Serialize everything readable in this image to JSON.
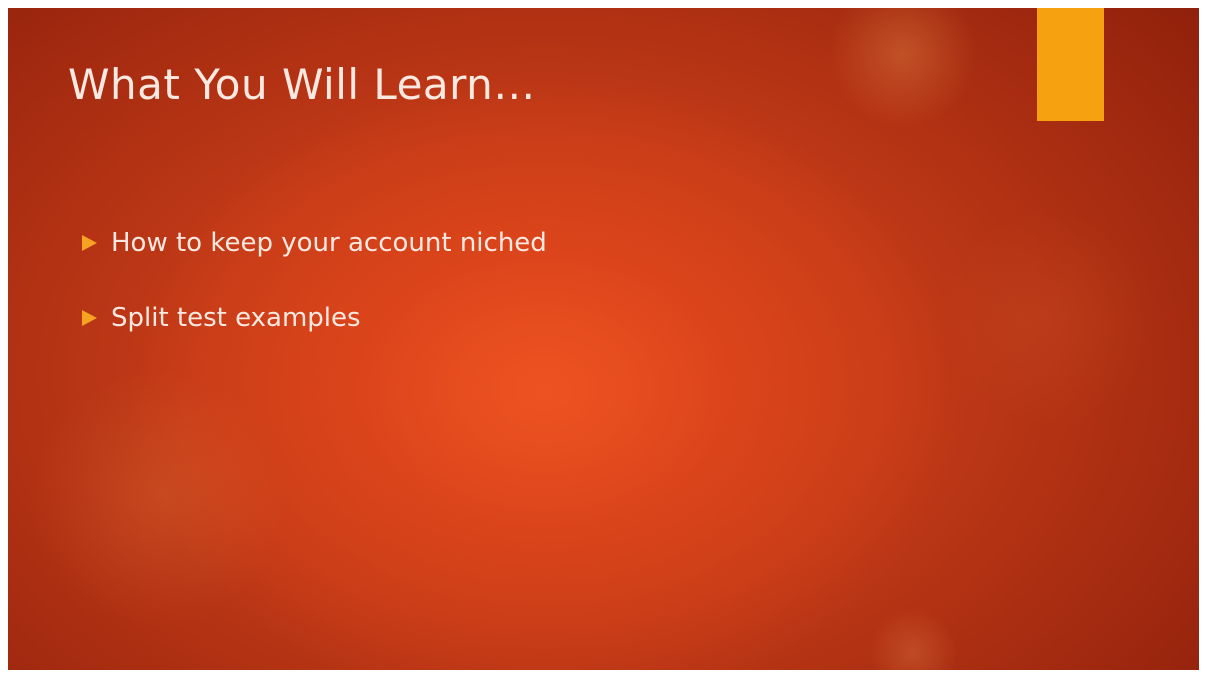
{
  "slide": {
    "title": "What You Will Learn…",
    "bullets": [
      {
        "text": "How to keep your account niched",
        "icon": "triangle-bullet-icon"
      },
      {
        "text": "Split test examples",
        "icon": "triangle-bullet-icon"
      }
    ]
  },
  "colors": {
    "background": "#c23a17",
    "accent": "#f6a10f",
    "bullet": "#f6a324",
    "text": "#fbe9e1"
  }
}
